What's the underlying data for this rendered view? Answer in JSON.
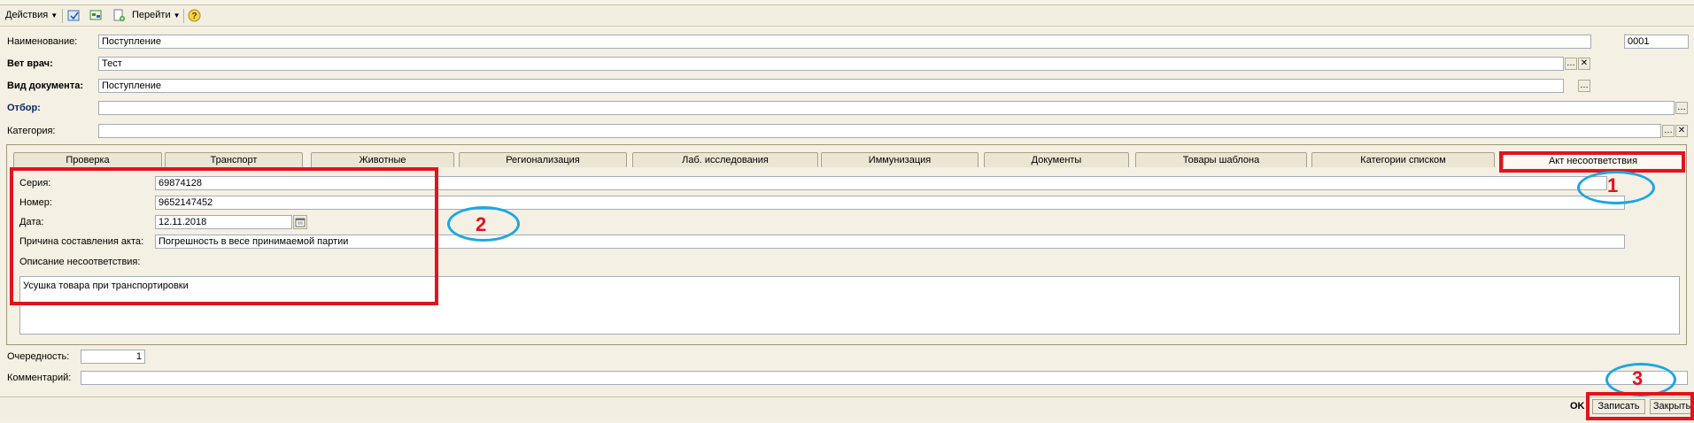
{
  "toolbar": {
    "actions_label": "Действия",
    "goto_label": "Перейти"
  },
  "header": {
    "name_label": "Наименование:",
    "name_value": "Поступление",
    "number_value": "0001",
    "vet_label": "Вет врач:",
    "vet_value": "Тест",
    "doc_type_label": "Вид документа:",
    "doc_type_value": "Поступление",
    "filter_label": "Отбор:",
    "filter_value": "",
    "category_label": "Категория:",
    "category_value": ""
  },
  "tabs": [
    {
      "label": "Проверка"
    },
    {
      "label": "Транспорт"
    },
    {
      "label": "Животные"
    },
    {
      "label": "Регионализация"
    },
    {
      "label": "Лаб. исследования"
    },
    {
      "label": "Иммунизация"
    },
    {
      "label": "Документы"
    },
    {
      "label": "Товары шаблона"
    },
    {
      "label": "Категории списком"
    },
    {
      "label": "Акт несоответствия",
      "active": true
    }
  ],
  "act": {
    "series_label": "Серия:",
    "series_value": "69874128",
    "number_label": "Номер:",
    "number_value": "9652147452",
    "date_label": "Дата:",
    "date_value": "12.11.2018",
    "reason_label": "Причина составления акта:",
    "reason_value": "Погрешность   в весе принимаемой партии",
    "description_label": "Описание несоответствия:",
    "description_value": "Усушка товара при транспортировки"
  },
  "footer": {
    "priority_label": "Очередность:",
    "priority_value": "1",
    "comment_label": "Комментарий:",
    "comment_value": ""
  },
  "buttons": {
    "ok": "OK",
    "save": "Записать",
    "close": "Закрыть"
  },
  "annotations": {
    "n1": "1",
    "n2": "2",
    "n3": "3"
  },
  "colors": {
    "annotation_red": "#e2131c",
    "annotation_blue": "#1ca6e4",
    "form_background": "#f4f0e3"
  }
}
